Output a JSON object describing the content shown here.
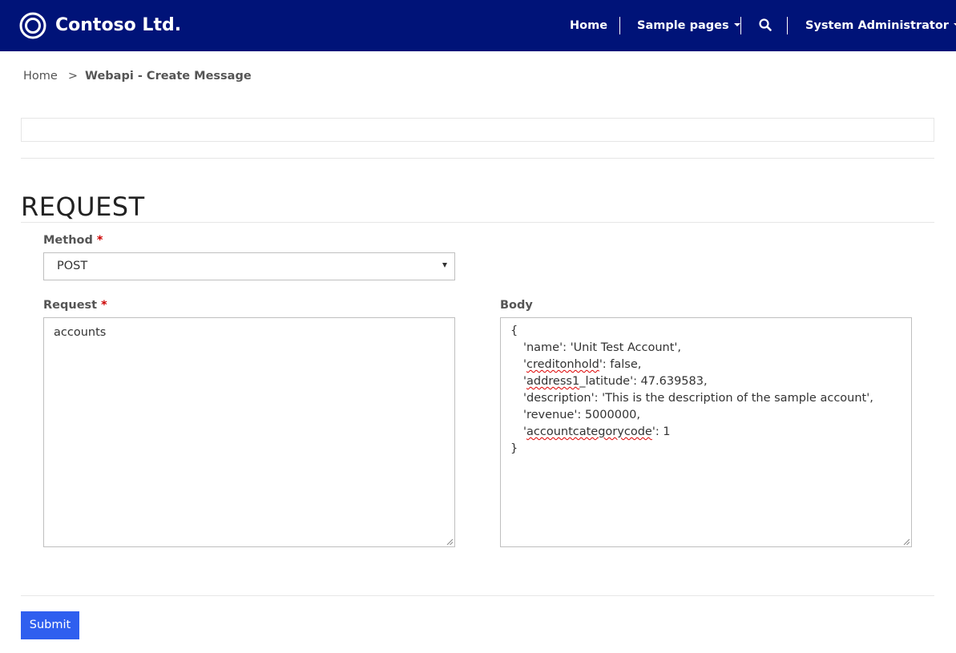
{
  "header": {
    "brand": "Contoso Ltd.",
    "nav": {
      "home": "Home",
      "sample_pages": "Sample pages",
      "user": "System Administrator"
    }
  },
  "breadcrumb": {
    "home": "Home",
    "separator": ">",
    "current": "Webapi - Create Message"
  },
  "section": {
    "title": "REQUEST"
  },
  "form": {
    "method": {
      "label": "Method",
      "required_mark": "*",
      "value": "POST"
    },
    "request": {
      "label": "Request",
      "required_mark": "*",
      "value": "accounts"
    },
    "body": {
      "label": "Body",
      "open": "{",
      "line1": "'name': 'Unit Test Account',",
      "line2_pre": "'",
      "line2_word": "creditonhold",
      "line2_post": "': false,",
      "line3_pre": "'",
      "line3_word": "address1",
      "line3_post": "_latitude': 47.639583,",
      "line4": "'description': 'This is the description of the sample account',",
      "line5": "'revenue': 5000000,",
      "line6_pre": "'",
      "line6_word": "accountcategorycode",
      "line6_post": "': 1",
      "close": "}"
    },
    "submit_label": "Submit"
  },
  "colors": {
    "navbar": "#001378",
    "submit": "#2f5fef",
    "required": "#cc0000"
  },
  "icons": [
    "contoso-logo-icon",
    "search-icon",
    "caret-down-icon",
    "select-arrow-icon"
  ]
}
